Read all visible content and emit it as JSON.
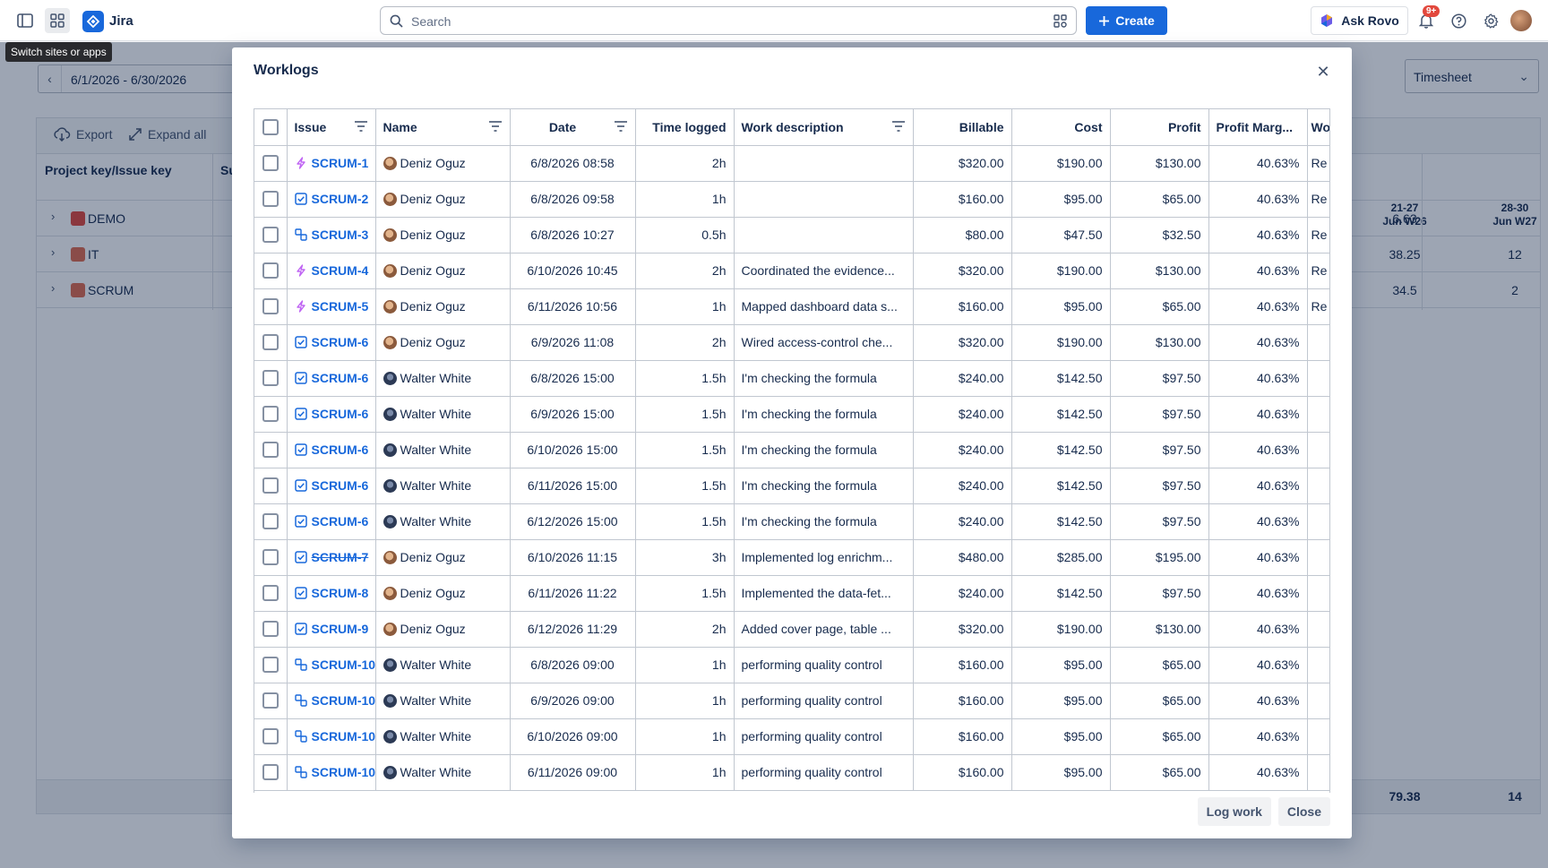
{
  "topnav": {
    "app_name": "Jira",
    "search_placeholder": "Search",
    "create_label": "Create",
    "rovo_label": "Ask Rovo",
    "notification_badge": "9+",
    "tooltip": "Switch sites or apps",
    "colors": {
      "brand": "#1868db",
      "badge": "#e2483d"
    }
  },
  "background": {
    "date_range": "6/1/2026 - 6/30/2026",
    "view_select": "Timesheet",
    "toolbar": {
      "export_label": "Export",
      "expand_label": "Expand all"
    },
    "grid_header": {
      "project_col": "Project key/Issue key",
      "partial_col": "Su"
    },
    "weeks": [
      {
        "range": "21-27",
        "label": "Jun W26"
      },
      {
        "range": "28-30",
        "label": "Jun W27"
      }
    ],
    "projects": [
      {
        "name": "DEMO",
        "w26": "6.63",
        "w27": ""
      },
      {
        "name": "IT",
        "w26": "38.25",
        "w27": "12"
      },
      {
        "name": "SCRUM",
        "w26": "34.5",
        "w27": "2"
      }
    ],
    "totals": {
      "w26": "79.38",
      "w27": "14"
    }
  },
  "modal": {
    "title": "Worklogs",
    "columns": {
      "issue": "Issue",
      "name": "Name",
      "date": "Date",
      "time": "Time logged",
      "desc": "Work description",
      "billable": "Billable",
      "cost": "Cost",
      "profit": "Profit",
      "margin": "Profit Marg...",
      "extra": "Wo"
    },
    "rows": [
      {
        "type": "epic",
        "key": "SCRUM-1",
        "strike": false,
        "name": "Deniz Oguz",
        "avatar": "deniz",
        "date": "6/8/2026 08:58",
        "time": "2h",
        "desc": "",
        "billable": "$320.00",
        "cost": "$190.00",
        "profit": "$130.00",
        "margin": "40.63%",
        "extra": "Re"
      },
      {
        "type": "task",
        "key": "SCRUM-2",
        "strike": false,
        "name": "Deniz Oguz",
        "avatar": "deniz",
        "date": "6/8/2026 09:58",
        "time": "1h",
        "desc": "",
        "billable": "$160.00",
        "cost": "$95.00",
        "profit": "$65.00",
        "margin": "40.63%",
        "extra": "Re"
      },
      {
        "type": "subtask",
        "key": "SCRUM-3",
        "strike": false,
        "name": "Deniz Oguz",
        "avatar": "deniz",
        "date": "6/8/2026 10:27",
        "time": "0.5h",
        "desc": "",
        "billable": "$80.00",
        "cost": "$47.50",
        "profit": "$32.50",
        "margin": "40.63%",
        "extra": "Re"
      },
      {
        "type": "epic",
        "key": "SCRUM-4",
        "strike": false,
        "name": "Deniz Oguz",
        "avatar": "deniz",
        "date": "6/10/2026 10:45",
        "time": "2h",
        "desc": "Coordinated the evidence...",
        "billable": "$320.00",
        "cost": "$190.00",
        "profit": "$130.00",
        "margin": "40.63%",
        "extra": "Re"
      },
      {
        "type": "epic",
        "key": "SCRUM-5",
        "strike": false,
        "name": "Deniz Oguz",
        "avatar": "deniz",
        "date": "6/11/2026 10:56",
        "time": "1h",
        "desc": "Mapped dashboard data s...",
        "billable": "$160.00",
        "cost": "$95.00",
        "profit": "$65.00",
        "margin": "40.63%",
        "extra": "Re"
      },
      {
        "type": "task",
        "key": "SCRUM-6",
        "strike": false,
        "name": "Deniz Oguz",
        "avatar": "deniz",
        "date": "6/9/2026 11:08",
        "time": "2h",
        "desc": "Wired access-control che...",
        "billable": "$320.00",
        "cost": "$190.00",
        "profit": "$130.00",
        "margin": "40.63%",
        "extra": ""
      },
      {
        "type": "task",
        "key": "SCRUM-6",
        "strike": false,
        "name": "Walter White",
        "avatar": "walter",
        "date": "6/8/2026 15:00",
        "time": "1.5h",
        "desc": "I'm checking the formula",
        "billable": "$240.00",
        "cost": "$142.50",
        "profit": "$97.50",
        "margin": "40.63%",
        "extra": ""
      },
      {
        "type": "task",
        "key": "SCRUM-6",
        "strike": false,
        "name": "Walter White",
        "avatar": "walter",
        "date": "6/9/2026 15:00",
        "time": "1.5h",
        "desc": "I'm checking the formula",
        "billable": "$240.00",
        "cost": "$142.50",
        "profit": "$97.50",
        "margin": "40.63%",
        "extra": ""
      },
      {
        "type": "task",
        "key": "SCRUM-6",
        "strike": false,
        "name": "Walter White",
        "avatar": "walter",
        "date": "6/10/2026 15:00",
        "time": "1.5h",
        "desc": "I'm checking the formula",
        "billable": "$240.00",
        "cost": "$142.50",
        "profit": "$97.50",
        "margin": "40.63%",
        "extra": ""
      },
      {
        "type": "task",
        "key": "SCRUM-6",
        "strike": false,
        "name": "Walter White",
        "avatar": "walter",
        "date": "6/11/2026 15:00",
        "time": "1.5h",
        "desc": "I'm checking the formula",
        "billable": "$240.00",
        "cost": "$142.50",
        "profit": "$97.50",
        "margin": "40.63%",
        "extra": ""
      },
      {
        "type": "task",
        "key": "SCRUM-6",
        "strike": false,
        "name": "Walter White",
        "avatar": "walter",
        "date": "6/12/2026 15:00",
        "time": "1.5h",
        "desc": "I'm checking the formula",
        "billable": "$240.00",
        "cost": "$142.50",
        "profit": "$97.50",
        "margin": "40.63%",
        "extra": ""
      },
      {
        "type": "task",
        "key": "SCRUM-7",
        "strike": true,
        "name": "Deniz Oguz",
        "avatar": "deniz",
        "date": "6/10/2026 11:15",
        "time": "3h",
        "desc": "Implemented log enrichm...",
        "billable": "$480.00",
        "cost": "$285.00",
        "profit": "$195.00",
        "margin": "40.63%",
        "extra": ""
      },
      {
        "type": "task",
        "key": "SCRUM-8",
        "strike": false,
        "name": "Deniz Oguz",
        "avatar": "deniz",
        "date": "6/11/2026 11:22",
        "time": "1.5h",
        "desc": "Implemented the data-fet...",
        "billable": "$240.00",
        "cost": "$142.50",
        "profit": "$97.50",
        "margin": "40.63%",
        "extra": ""
      },
      {
        "type": "task",
        "key": "SCRUM-9",
        "strike": false,
        "name": "Deniz Oguz",
        "avatar": "deniz",
        "date": "6/12/2026 11:29",
        "time": "2h",
        "desc": "Added cover page, table ...",
        "billable": "$320.00",
        "cost": "$190.00",
        "profit": "$130.00",
        "margin": "40.63%",
        "extra": ""
      },
      {
        "type": "subtask",
        "key": "SCRUM-10",
        "strike": false,
        "name": "Walter White",
        "avatar": "walter",
        "date": "6/8/2026 09:00",
        "time": "1h",
        "desc": "performing quality control",
        "billable": "$160.00",
        "cost": "$95.00",
        "profit": "$65.00",
        "margin": "40.63%",
        "extra": ""
      },
      {
        "type": "subtask",
        "key": "SCRUM-10",
        "strike": false,
        "name": "Walter White",
        "avatar": "walter",
        "date": "6/9/2026 09:00",
        "time": "1h",
        "desc": "performing quality control",
        "billable": "$160.00",
        "cost": "$95.00",
        "profit": "$65.00",
        "margin": "40.63%",
        "extra": ""
      },
      {
        "type": "subtask",
        "key": "SCRUM-10",
        "strike": false,
        "name": "Walter White",
        "avatar": "walter",
        "date": "6/10/2026 09:00",
        "time": "1h",
        "desc": "performing quality control",
        "billable": "$160.00",
        "cost": "$95.00",
        "profit": "$65.00",
        "margin": "40.63%",
        "extra": ""
      },
      {
        "type": "subtask",
        "key": "SCRUM-10",
        "strike": false,
        "name": "Walter White",
        "avatar": "walter",
        "date": "6/11/2026 09:00",
        "time": "1h",
        "desc": "performing quality control",
        "billable": "$160.00",
        "cost": "$95.00",
        "profit": "$65.00",
        "margin": "40.63%",
        "extra": ""
      }
    ],
    "buttons": {
      "log_work": "Log work",
      "close": "Close"
    }
  }
}
